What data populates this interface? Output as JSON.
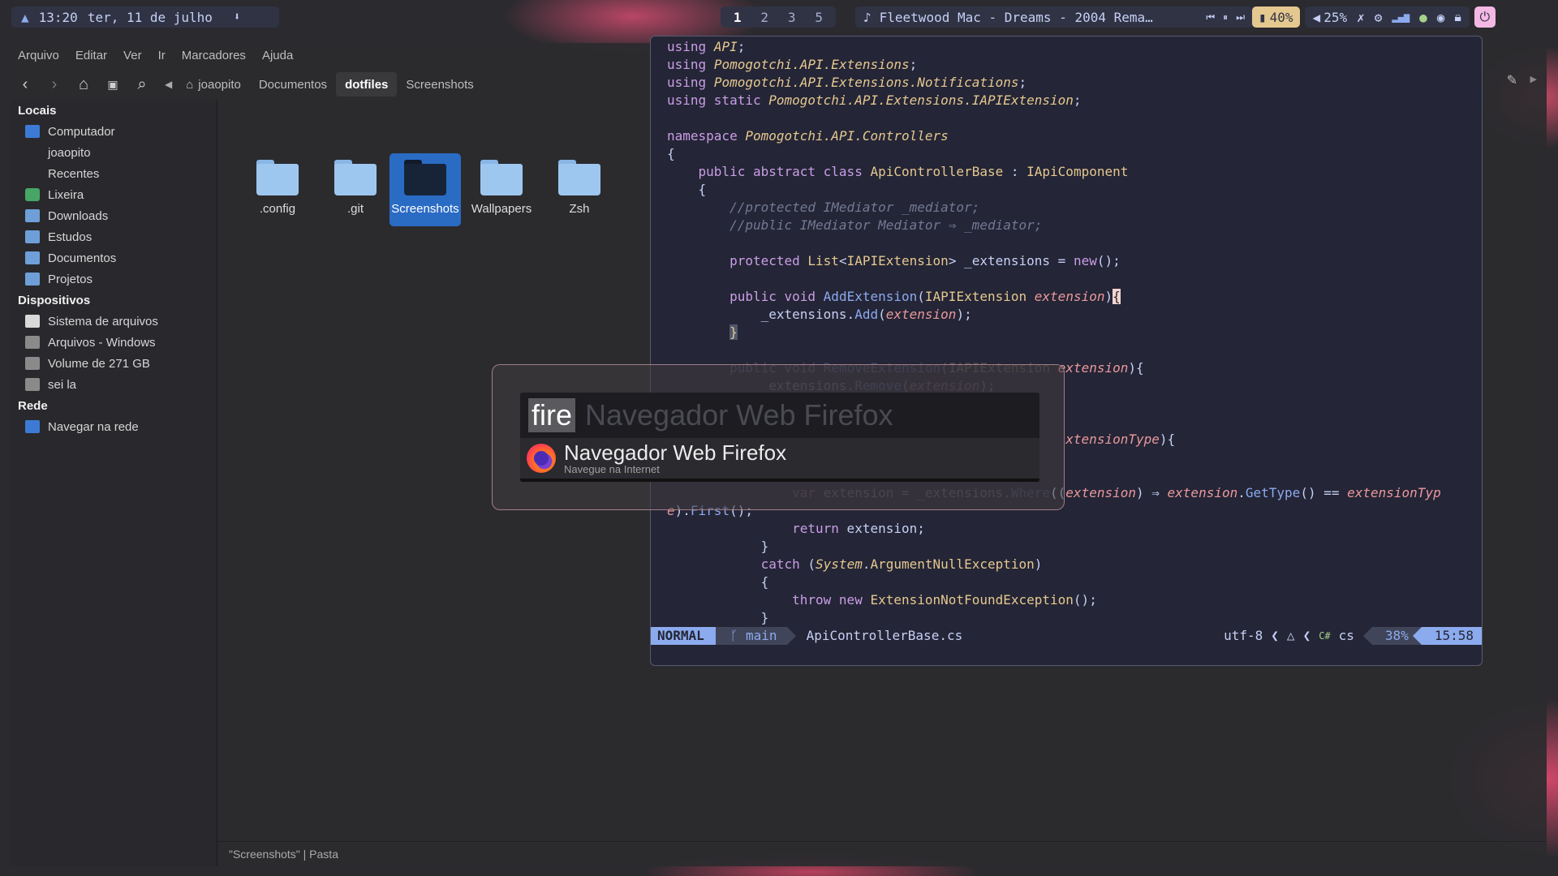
{
  "topbar": {
    "time": "13:20",
    "date": "ter, 11 de julho",
    "workspaces": [
      "1",
      "2",
      "3",
      "5"
    ],
    "active_workspace": "1",
    "media_title": "Fleetwood Mac - Dreams - 2004 Rema…",
    "battery": "40%",
    "volume": "25%"
  },
  "file_manager": {
    "menu": [
      "Arquivo",
      "Editar",
      "Ver",
      "Ir",
      "Marcadores",
      "Ajuda"
    ],
    "breadcrumbs": [
      "joaopito",
      "Documentos",
      "dotfiles",
      "Screenshots"
    ],
    "current_crumb": "dotfiles",
    "sidebar": {
      "locais_title": "Locais",
      "locais": [
        "Computador",
        "joaopito",
        "Recentes",
        "Lixeira",
        "Downloads",
        "Estudos",
        "Documentos",
        "Projetos"
      ],
      "dispositivos_title": "Dispositivos",
      "dispositivos": [
        "Sistema de arquivos",
        "Arquivos - Windows",
        "Volume de 271 GB",
        "sei la"
      ],
      "rede_title": "Rede",
      "rede": [
        "Navegar na rede"
      ]
    },
    "files": [
      ".config",
      ".git",
      "Screenshots",
      "Wallpapers",
      "Zsh"
    ],
    "selected_file": "Screenshots",
    "status": "\"Screenshots\" | Pasta"
  },
  "editor": {
    "mode": "NORMAL",
    "branch": "main",
    "filename": "ApiControllerBase.cs",
    "encoding": "utf-8",
    "filetype": "cs",
    "percent": "38%",
    "position": "15:58"
  },
  "launcher": {
    "query": "fire",
    "placeholder": "Navegador Web Firefox",
    "result_name": "Navegador Web Firefox",
    "result_description": "Navegue na Internet"
  },
  "colors": {
    "accent": "#8caaee",
    "selection": "#2a6bc4",
    "battery_bg": "#e5c890",
    "power_bg": "#f4b8e4"
  }
}
